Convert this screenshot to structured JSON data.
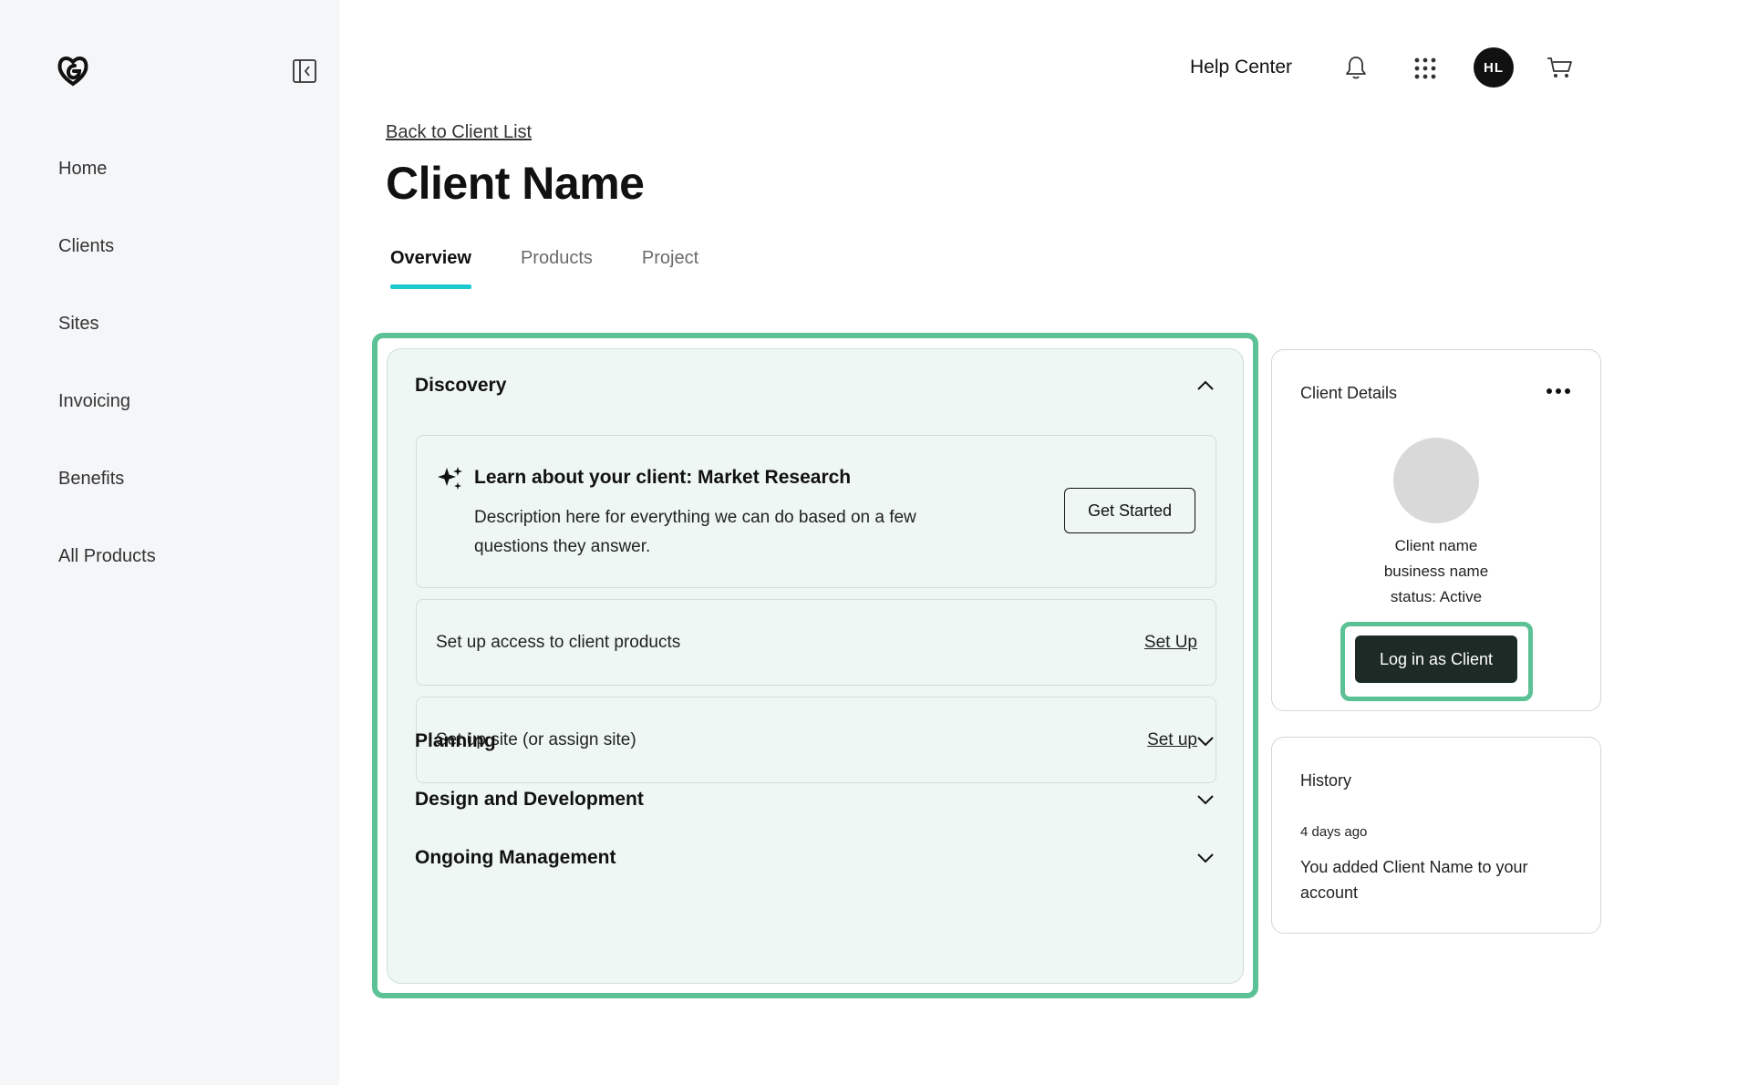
{
  "sidebar": {
    "logo_icon": "godaddy-logo-icon",
    "collapse_icon": "collapse-sidebar-icon",
    "items": [
      {
        "label": "Home"
      },
      {
        "label": "Clients"
      },
      {
        "label": "Sites"
      },
      {
        "label": "Invoicing"
      },
      {
        "label": "Benefits"
      },
      {
        "label": "All Products"
      }
    ]
  },
  "header": {
    "help_center": "Help Center",
    "avatar_initials": "HL"
  },
  "page": {
    "back_link": "Back to Client List",
    "title": "Client Name",
    "tabs": [
      {
        "label": "Overview",
        "active": true
      },
      {
        "label": "Products",
        "active": false
      },
      {
        "label": "Project",
        "active": false
      }
    ]
  },
  "workflow": {
    "discovery": {
      "label": "Discovery",
      "expanded": true,
      "research": {
        "title": "Learn about your client: Market Research",
        "description": "Description here for everything we can do based on a few questions they answer.",
        "button": "Get Started"
      },
      "tasks": [
        {
          "text": "Set up access to client products",
          "link": "Set Up"
        },
        {
          "text": "Set up site (or assign site)",
          "link": "Set up"
        }
      ]
    },
    "sections": [
      {
        "label": "Planning",
        "expanded": false
      },
      {
        "label": "Design and Development",
        "expanded": false
      },
      {
        "label": "Ongoing Management",
        "expanded": false
      }
    ]
  },
  "client_details": {
    "title": "Client Details",
    "name": "Client name",
    "business": "business name",
    "status": "status: Active",
    "login_button": "Log in as Client"
  },
  "history": {
    "title": "History",
    "time": "4 days ago",
    "text": "You added Client Name to your account"
  },
  "colors": {
    "accent_tab": "#1bc9cf",
    "highlight": "#5cc295",
    "panel_bg": "#eef7f3",
    "sidebar_bg": "#f5f6f8",
    "button_dark": "#1d2a26"
  }
}
